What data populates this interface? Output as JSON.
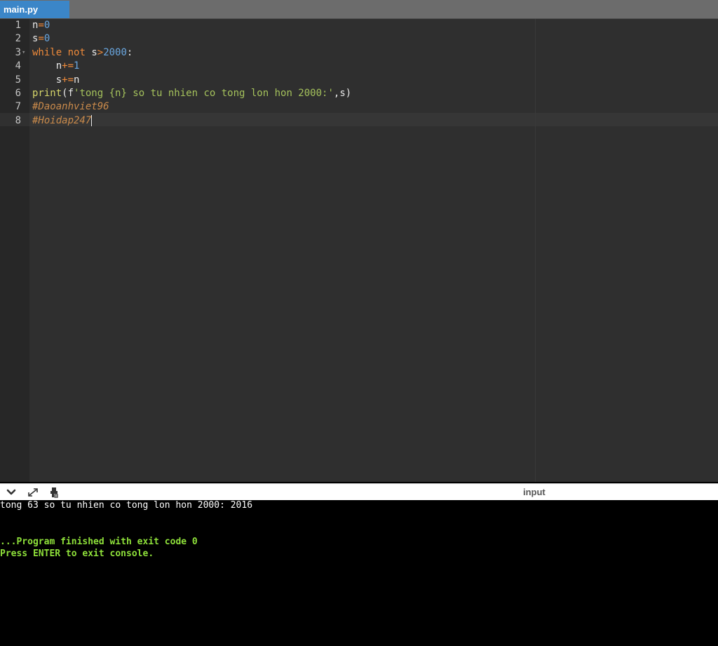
{
  "tab": {
    "filename": "main.py"
  },
  "editor": {
    "line_numbers": [
      "1",
      "2",
      "3",
      "4",
      "5",
      "6",
      "7",
      "8"
    ],
    "lines": [
      [
        {
          "t": "n",
          "c": ""
        },
        {
          "t": "=",
          "c": "op"
        },
        {
          "t": "0",
          "c": "num"
        }
      ],
      [
        {
          "t": "s",
          "c": ""
        },
        {
          "t": "=",
          "c": "op"
        },
        {
          "t": "0",
          "c": "num"
        }
      ],
      [
        {
          "t": "while",
          "c": "kw"
        },
        {
          "t": " ",
          "c": ""
        },
        {
          "t": "not",
          "c": "kw"
        },
        {
          "t": " s",
          "c": ""
        },
        {
          "t": ">",
          "c": "op"
        },
        {
          "t": "2000",
          "c": "num"
        },
        {
          "t": ":",
          "c": ""
        }
      ],
      [
        {
          "t": "    n",
          "c": ""
        },
        {
          "t": "+=",
          "c": "op"
        },
        {
          "t": "1",
          "c": "num"
        }
      ],
      [
        {
          "t": "    s",
          "c": ""
        },
        {
          "t": "+=",
          "c": "op"
        },
        {
          "t": "n",
          "c": ""
        }
      ],
      [
        {
          "t": "print",
          "c": "fn"
        },
        {
          "t": "(f",
          "c": ""
        },
        {
          "t": "'tong {n} so tu nhien co tong lon hon 2000:'",
          "c": "str"
        },
        {
          "t": ",s)",
          "c": ""
        }
      ],
      [
        {
          "t": "#Daoanhviet96",
          "c": "cmt"
        }
      ],
      [
        {
          "t": "#Hoidap247",
          "c": "cmt"
        }
      ]
    ]
  },
  "console_bar": {
    "input_label": "input",
    "icons": [
      "chevron-down-icon",
      "expand-icon",
      "settings-icon"
    ]
  },
  "console": {
    "output_line": "tong 63 so tu nhien co tong lon hon 2000: 2016",
    "finished_line": "...Program finished with exit code 0",
    "exit_line": "Press ENTER to exit console."
  }
}
